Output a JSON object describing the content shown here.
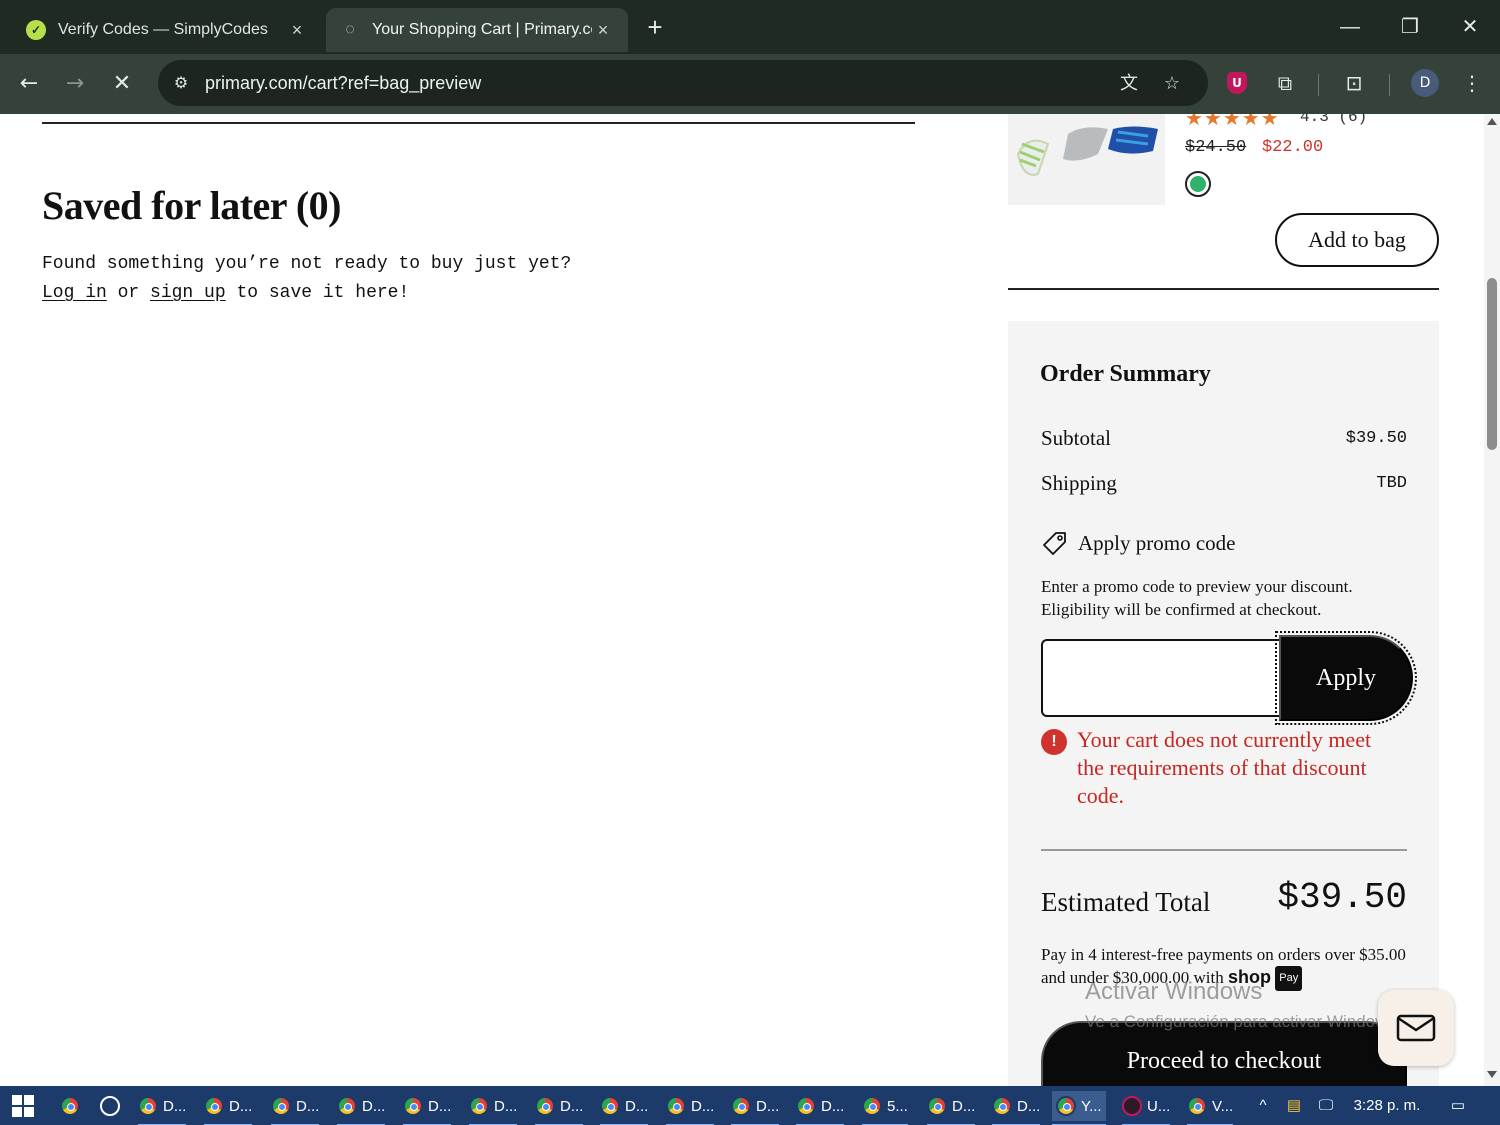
{
  "browser": {
    "tabs": [
      {
        "title": "Verify Codes — SimplyCodes",
        "active": false
      },
      {
        "title": "Your Shopping Cart | Primary.co",
        "active": true
      }
    ],
    "new_tab": "+",
    "window_controls": {
      "minimize": "—",
      "restore": "❐",
      "close": "✕"
    },
    "url": "primary.com/cart?ref=bag_preview",
    "profile_initial": "D",
    "extension_badge": "U"
  },
  "saved_for_later": {
    "title": "Saved for later (0)",
    "line1": "Found something you’re not ready to buy just yet?",
    "login_link": "Log in",
    "or_text": " or ",
    "signup_link": "sign up",
    "tail_text": " to save it here!"
  },
  "recommendation": {
    "stars": "★★★★★",
    "rating_text": "4.3 (6)",
    "rating_value": 4.3,
    "price_original": "$24.50",
    "price_sale": "$22.00",
    "swatch_color": "#2fb36b",
    "add_to_bag": "Add to bag"
  },
  "order_summary": {
    "title": "Order Summary",
    "subtotal_label": "Subtotal",
    "subtotal_value": "$39.50",
    "shipping_label": "Shipping",
    "shipping_value": "TBD",
    "promo_label": "Apply promo code",
    "promo_help": "Enter a promo code to preview your discount. Eligibility will be confirmed at checkout.",
    "promo_input_value": "",
    "apply_label": "Apply",
    "error_icon": "!",
    "error_message": "Your cart does not currently meet the requirements of that discount code.",
    "estimated_total_label": "Estimated Total",
    "estimated_total_value": "$39.50",
    "installments_text": "Pay in 4 interest-free payments on orders over $35.00 and under $30,000.00 with",
    "shop_logo": "shop",
    "pay_badge": "Pay",
    "checkout_label": "Proceed to checkout"
  },
  "watermark": {
    "line1": "Activar Windows",
    "line2": "Ve a Configuración para activar Windows."
  },
  "taskbar": {
    "apps": [
      "D...",
      "D...",
      "D...",
      "D...",
      "D...",
      "D...",
      "D...",
      "D...",
      "D...",
      "D...",
      "D...",
      "5...",
      "D...",
      "D...",
      "Y...",
      "U...",
      "V..."
    ],
    "clock": "3:28 p. m.",
    "tray_chevron": "^"
  },
  "colors": {
    "accent_error": "#c8261f",
    "sale_price": "#d0322c",
    "star": "#e8772e",
    "taskbar": "#1c3b6b"
  }
}
